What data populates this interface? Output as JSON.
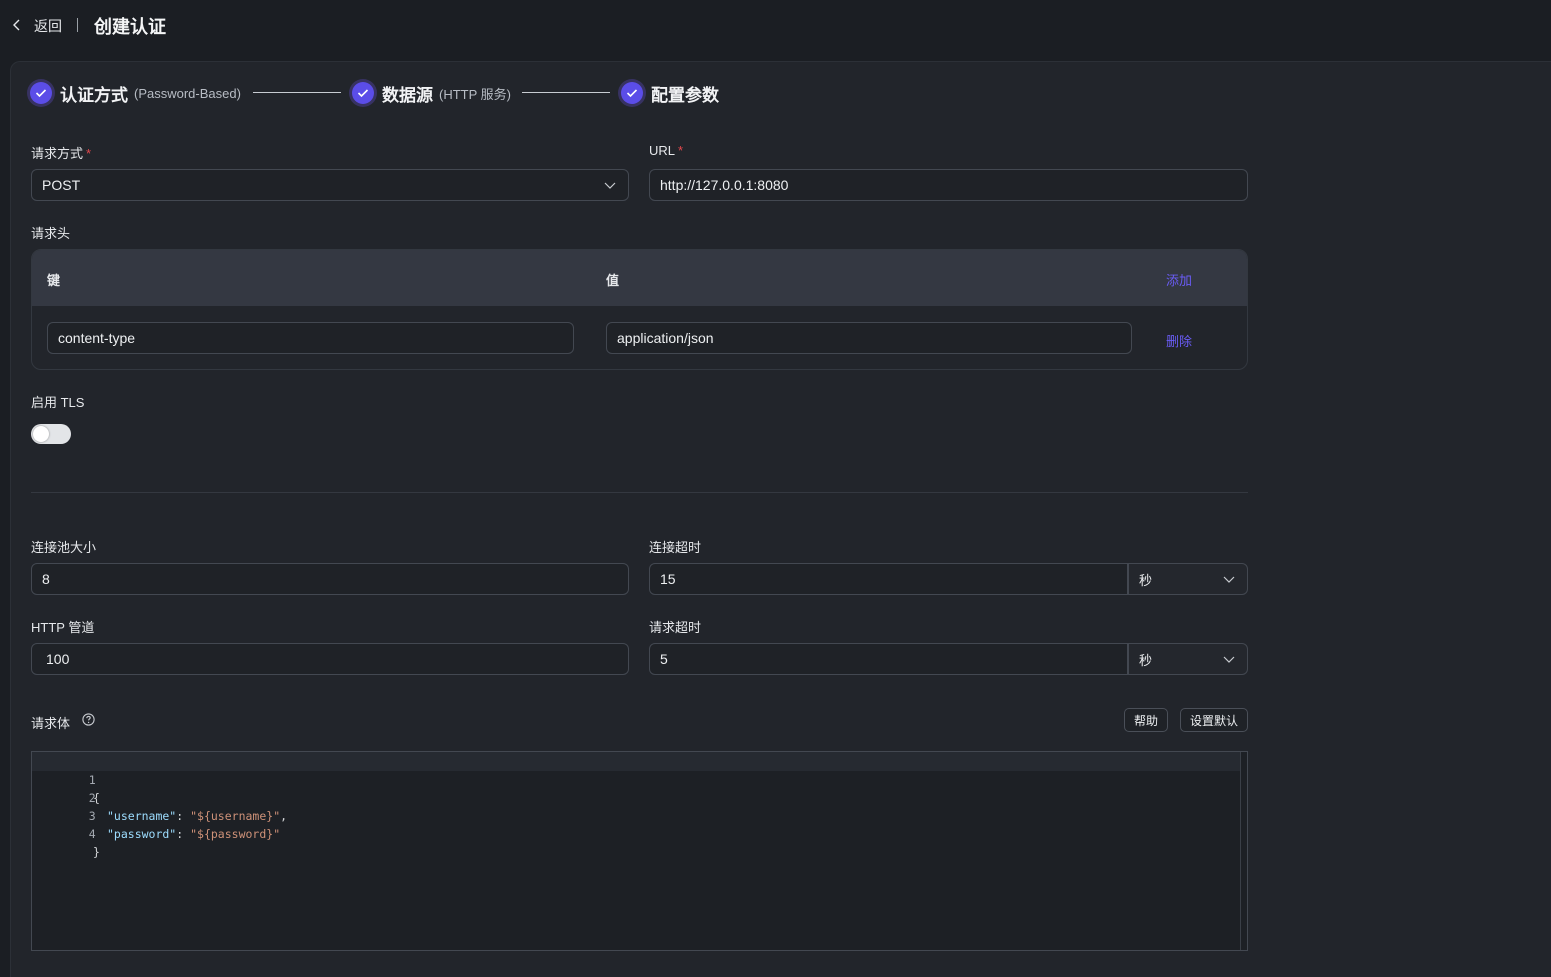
{
  "header": {
    "back_label": "返回",
    "title": "创建认证"
  },
  "steps": [
    {
      "title": "认证方式",
      "sub": "(Password-Based)",
      "status": "done"
    },
    {
      "title": "数据源",
      "sub": "(HTTP 服务)",
      "status": "done"
    },
    {
      "title": "配置参数",
      "sub": "",
      "status": "done"
    }
  ],
  "form": {
    "method": {
      "label": "请求方式",
      "value": "POST"
    },
    "url": {
      "label": "URL",
      "value": "http://127.0.0.1:8080"
    },
    "headers": {
      "label": "请求头",
      "col_key": "键",
      "col_value": "值",
      "add_label": "添加",
      "rows": [
        {
          "key": "content-type",
          "value": "application/json",
          "delete_label": "删除"
        }
      ]
    },
    "tls": {
      "label": "启用 TLS",
      "enabled": false
    },
    "pool_size": {
      "label": "连接池大小",
      "value": "8"
    },
    "conn_timeout": {
      "label": "连接超时",
      "value": "15",
      "unit": "秒"
    },
    "pipeline": {
      "label": "HTTP 管道",
      "value": "100"
    },
    "req_timeout": {
      "label": "请求超时",
      "value": "5",
      "unit": "秒"
    },
    "body": {
      "label": "请求体",
      "help_label": "帮助",
      "default_label": "设置默认",
      "lines": [
        {
          "n": "1",
          "text": "{"
        },
        {
          "n": "2",
          "key": "\"username\"",
          "sep": ": ",
          "val": "\"${username}\"",
          "tail": ","
        },
        {
          "n": "3",
          "key": "\"password\"",
          "sep": ": ",
          "val": "\"${password}\"",
          "tail": ""
        },
        {
          "n": "4",
          "text": "}"
        }
      ]
    }
  },
  "colors": {
    "accent": "#5b4de8",
    "link": "#6a5cf5",
    "required": "#e5484d"
  }
}
